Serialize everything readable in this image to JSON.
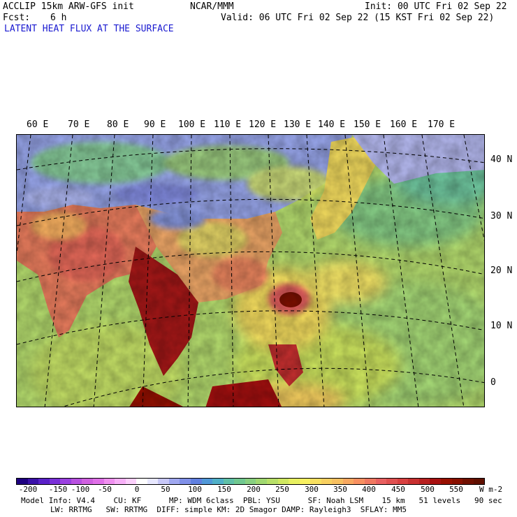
{
  "header": {
    "title_left": "ACCLIP 15km ARW-GFS init",
    "center": "NCAR/MMM",
    "init": "Init: 00 UTC Fri 02 Sep 22",
    "fcst_label": "Fcst:",
    "fcst_value": "6 h",
    "valid": "Valid: 06 UTC Fri 02 Sep 22 (15 KST Fri 02 Sep 22)",
    "field": "LATENT HEAT FLUX AT THE SURFACE"
  },
  "map": {
    "lon_labels": [
      "60 E",
      "70 E",
      "80 E",
      "90 E",
      "100 E",
      "110 E",
      "120 E",
      "130 E",
      "140 E",
      "150 E",
      "160 E",
      "170 E"
    ],
    "lat_labels": [
      "40 N",
      "30 N",
      "20 N",
      "10 N",
      "0"
    ]
  },
  "colorbar": {
    "ticks": [
      "-200",
      "-150",
      "-100",
      "-50",
      "0",
      "50",
      "100",
      "150",
      "200",
      "250",
      "300",
      "350",
      "400",
      "450",
      "500",
      "550"
    ],
    "unit": "W m-2",
    "colors": [
      "#1e0080",
      "#3a10a8",
      "#5a20c8",
      "#7a30d8",
      "#9a40e0",
      "#b850e0",
      "#d060e0",
      "#e070e8",
      "#f090f0",
      "#f8b0f8",
      "#fcd0fc",
      "#ffffff",
      "#e8e8ff",
      "#c8c8f8",
      "#a0a8f0",
      "#8090e8",
      "#6080e0",
      "#5098d8",
      "#50b0c8",
      "#60c0a8",
      "#70c890",
      "#88d080",
      "#a0d870",
      "#b8e068",
      "#d0e860",
      "#e8f060",
      "#f8f060",
      "#f8e060",
      "#f8d060",
      "#f8c060",
      "#f8a860",
      "#f89060",
      "#f07860",
      "#e86060",
      "#e05050",
      "#d84040",
      "#c83030",
      "#b82020",
      "#a81010",
      "#981000",
      "#881000",
      "#701000",
      "#601000"
    ]
  },
  "footer": {
    "line1": "Model Info: V4.4    CU: KF      MP: WDM 6class  PBL: YSU      SF: Noah LSM    15 km   51 levels   90 sec",
    "line2": "LW: RRTMG   SW: RRTMG  DIFF: simple KM: 2D Smagor DAMP: Rayleigh3  SFLAY: MM5"
  }
}
